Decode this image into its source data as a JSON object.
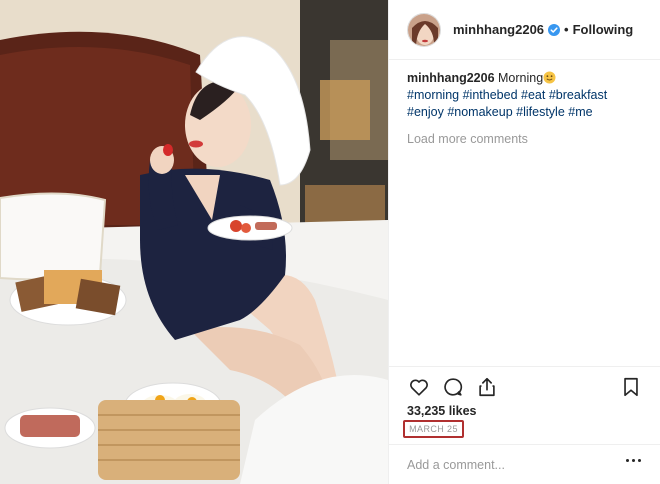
{
  "post": {
    "username": "minhhang2206",
    "follow_state": "Following",
    "separator": "•",
    "verified_icon": "verified-badge-icon"
  },
  "caption": {
    "username": "minhhang2206",
    "text": "Morning",
    "emoji": "smiling-face-emoji",
    "hashtags": [
      "#morning",
      "#inthebed",
      "#eat",
      "#breakfast",
      "#enjoy",
      "#nomakeup",
      "#lifestyle",
      "#me"
    ]
  },
  "comments": {
    "load_more": "Load more comments"
  },
  "actions": {
    "icons": [
      "heart-icon",
      "comment-icon",
      "share-icon",
      "bookmark-icon"
    ]
  },
  "stats": {
    "likes": "33,235 likes",
    "date": "MARCH 25"
  },
  "add_comment": {
    "placeholder": "Add a comment..."
  },
  "colors": {
    "hashtag": "#003569",
    "muted": "#999999",
    "date_highlight": "#b03030",
    "verified": "#3897f0"
  }
}
